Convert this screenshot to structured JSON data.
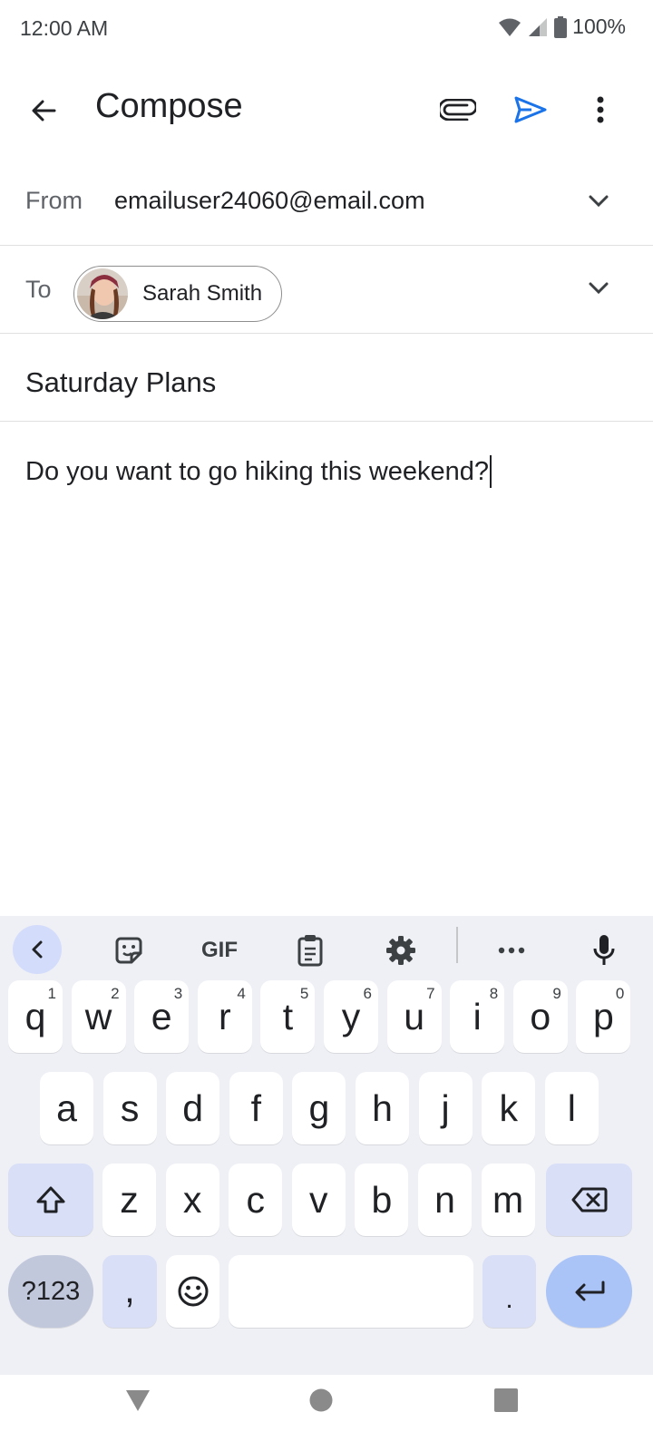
{
  "status_bar": {
    "time": "12:00 AM",
    "battery": "100%"
  },
  "app_bar": {
    "title": "Compose"
  },
  "compose": {
    "from_label": "From",
    "from_value": "emailuser24060@email.com",
    "to_label": "To",
    "to_recipient": "Sarah Smith",
    "subject": "Saturday Plans",
    "body": "Do you want to go hiking this weekend?"
  },
  "keyboard": {
    "toolbar": {
      "gif": "GIF"
    },
    "row1": [
      {
        "k": "q",
        "h": "1"
      },
      {
        "k": "w",
        "h": "2"
      },
      {
        "k": "e",
        "h": "3"
      },
      {
        "k": "r",
        "h": "4"
      },
      {
        "k": "t",
        "h": "5"
      },
      {
        "k": "y",
        "h": "6"
      },
      {
        "k": "u",
        "h": "7"
      },
      {
        "k": "i",
        "h": "8"
      },
      {
        "k": "o",
        "h": "9"
      },
      {
        "k": "p",
        "h": "0"
      }
    ],
    "row2": [
      "a",
      "s",
      "d",
      "f",
      "g",
      "h",
      "j",
      "k",
      "l"
    ],
    "row3": [
      "z",
      "x",
      "c",
      "v",
      "b",
      "n",
      "m"
    ],
    "symbols_label": "?123",
    "comma": ",",
    "period": "."
  },
  "colors": {
    "accent": "#1a73e8",
    "keyboard_bg": "#eef0f6"
  }
}
